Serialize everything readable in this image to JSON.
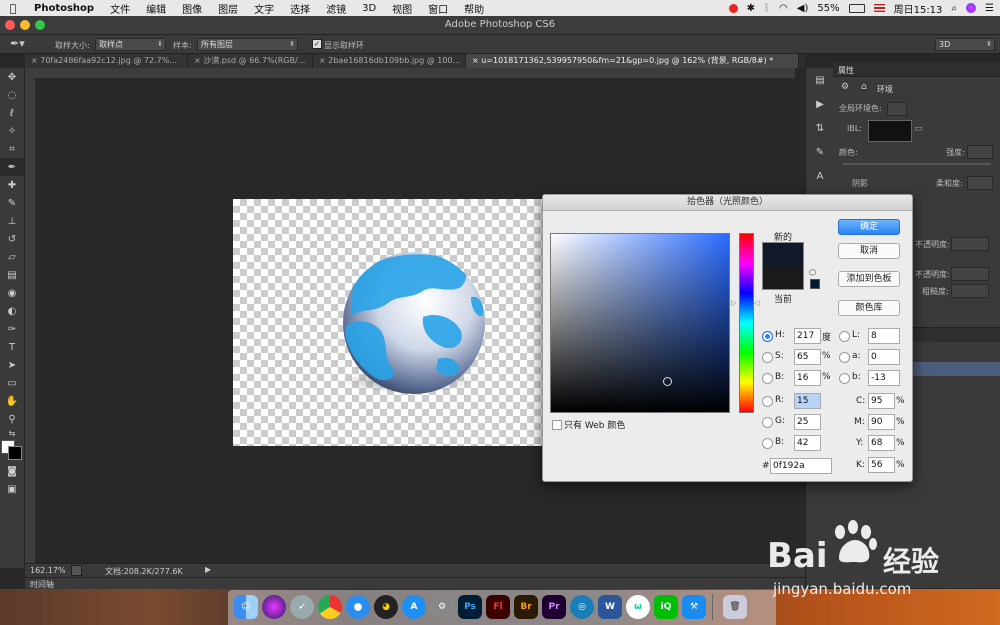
{
  "menubar": {
    "app": "Photoshop",
    "items": [
      "文件",
      "编辑",
      "图像",
      "图层",
      "文字",
      "选择",
      "滤镜",
      "3D",
      "视图",
      "窗口",
      "帮助"
    ],
    "battery": "55%",
    "datetime": "周日15:13"
  },
  "window": {
    "title": "Adobe Photoshop CS6"
  },
  "options": {
    "sample_size_label": "取样大小:",
    "sample_size_value": "取样点",
    "sample_label": "样本:",
    "sample_value": "所有图层",
    "show_ring_label": "显示取样环",
    "workspace": "3D"
  },
  "tabs": [
    {
      "label": "70fa2486faa92c12.jpg @ 72.7%..."
    },
    {
      "label": "沙漠.psd @ 66.7%(RGB/..."
    },
    {
      "label": "2bae16816db109bb.jpg @ 100..."
    },
    {
      "label": "u=1018171362,539957950&fm=21&gp=0.jpg @ 162% (背景, RGB/8#) *"
    }
  ],
  "status": {
    "zoom": "162.17%",
    "doc": "文档:208.2K/277.6K",
    "timeline": "时间轴"
  },
  "properties": {
    "title": "属性",
    "section": "环境",
    "global_ambient": "全局环境色:",
    "ibl": "IBL:",
    "color": "颜色:",
    "intensity": "强度:",
    "shadow": "阴影",
    "softness": "柔和度:",
    "opacity1": "不透明度:",
    "opacity2": "不透明度:",
    "roughness": "粗糙度:"
  },
  "color_picker": {
    "title": "拾色器（光照颜色）",
    "new_label": "新的",
    "current_label": "当前",
    "ok": "确定",
    "cancel": "取消",
    "add_swatch": "添加到色板",
    "color_libraries": "颜色库",
    "web_only": "只有 Web 颜色",
    "H": "217",
    "H_unit": "度",
    "S": "65",
    "S_unit": "%",
    "B": "16",
    "B_unit": "%",
    "R": "15",
    "G": "25",
    "Bv": "42",
    "L": "8",
    "a": "0",
    "b": "-13",
    "C": "95",
    "M": "90",
    "Y": "68",
    "K": "56",
    "hex": "0f192a",
    "new_color": "#0f192a",
    "current_color": "#1a1a1a"
  },
  "watermark": {
    "brand": "Bai",
    "brand2": "经验",
    "url": "jingyan.baidu.com"
  }
}
